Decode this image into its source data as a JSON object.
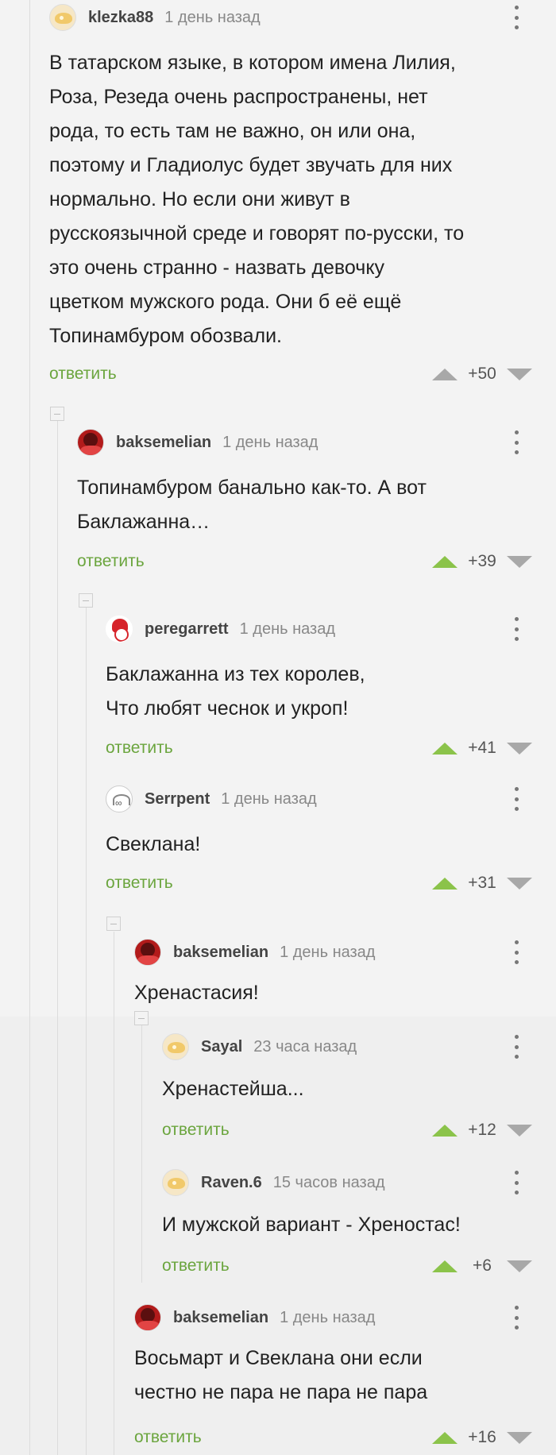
{
  "reply_label": "ответить",
  "comments": [
    {
      "user": "klezka88",
      "time": "1 день назад",
      "avatar": "lemon-avatar",
      "text": "В татарском языке, в котором имена Лилия,\nРоза, Резеда очень распространены, нет\nрода, то есть там не важно, он или она,\nпоэтому и Гладиолус будет звучать для них\nнормально. Но если они живут в\nрусскоязычной среде и говорят по-русски, то\nэто очень странно - назвать девочку\nцветком мужского рода. Они б её ещё\nТопинамбуром обозвали.",
      "score": "+50",
      "upvoted": false
    },
    {
      "user": "baksemelian",
      "time": "1 день назад",
      "avatar": "red-avatar",
      "text": "Топинамбуром банально как-то. А вот\nБаклажанна…",
      "score": "+39",
      "upvoted": true
    },
    {
      "user": "peregarrett",
      "time": "1 день назад",
      "avatar": "clown-avatar",
      "text": "Баклажанна из тех королев,\nЧто любят чеснок и укроп!",
      "score": "+41",
      "upvoted": true
    },
    {
      "user": "Serrpent",
      "time": "1 день назад",
      "avatar": "sketch-avatar",
      "text": "Свеклана!",
      "score": "+31",
      "upvoted": true
    },
    {
      "user": "baksemelian",
      "time": "1 день назад",
      "avatar": "red-avatar",
      "text": "Хренастасия!",
      "score": "",
      "upvoted": true
    },
    {
      "user": "Sayal",
      "time": "23 часа назад",
      "avatar": "lemon-avatar",
      "text": "Хренастейша...",
      "score": "+12",
      "upvoted": true
    },
    {
      "user": "Raven.6",
      "time": "15 часов назад",
      "avatar": "lemon-avatar",
      "text": "И мужской вариант - Хреностас!",
      "score": "+6",
      "upvoted": true
    },
    {
      "user": "baksemelian",
      "time": "1 день назад",
      "avatar": "red-avatar",
      "text": "Восьмарт и Свеклана они если\nчестно не пара не пара не пара",
      "score": "+16",
      "upvoted": true
    }
  ],
  "colors": {
    "accent": "#6ba53e",
    "upvote": "#8bc34a",
    "neutral": "#a8a8a8"
  }
}
